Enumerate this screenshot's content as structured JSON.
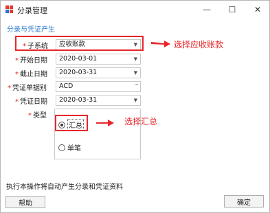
{
  "window": {
    "title": "分录管理",
    "minimize_glyph": "—",
    "maximize_glyph": "☐",
    "close_glyph": "✕"
  },
  "section_title": "分录与凭证产生",
  "form": {
    "required_mark": "*",
    "subsystem": {
      "label": "子系统",
      "value": "应收账款"
    },
    "start_date": {
      "label": "开始日期",
      "value": "2020-03-01"
    },
    "end_date": {
      "label": "截止日期",
      "value": "2020-03-31"
    },
    "voucher_basis": {
      "label": "凭证单据别",
      "value": "ACD",
      "button_glyph": "···"
    },
    "voucher_date": {
      "label": "凭证日期",
      "value": "2020-03-31"
    },
    "type": {
      "label": "类型",
      "options": [
        {
          "label": "汇总",
          "selected": true
        },
        {
          "label": "单笔",
          "selected": false
        }
      ]
    }
  },
  "annotations": {
    "select_ar": "选择应收账款",
    "select_summary": "选择汇总"
  },
  "footer_text": "执行本操作将自动产生分录和凭证资料",
  "buttons": {
    "help": "帮助",
    "ok": "确定"
  },
  "colors": {
    "accent": "#2f7dd1",
    "required": "#e02020",
    "annotation": "#e8262a"
  }
}
